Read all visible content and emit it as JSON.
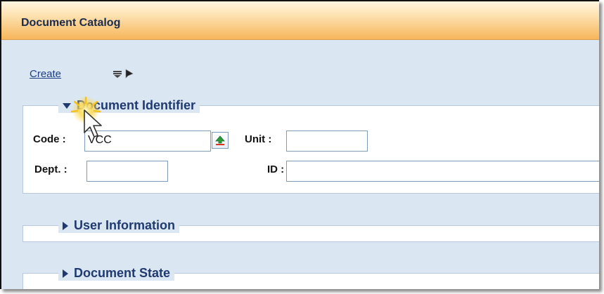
{
  "window": {
    "title": "Document Catalog"
  },
  "toolbar": {
    "create_label": "Create"
  },
  "sections": {
    "document_identifier": {
      "legend": "Document Identifier",
      "expanded": true,
      "fields": {
        "code": {
          "label": "Code :",
          "value": "VCC"
        },
        "unit": {
          "label": "Unit :",
          "value": ""
        },
        "dept": {
          "label": "Dept. :",
          "value": ""
        },
        "id": {
          "label": "ID :",
          "value": ""
        }
      }
    },
    "user_information": {
      "legend": "User Information",
      "expanded": false
    },
    "document_state": {
      "legend": "Document State",
      "expanded": false
    }
  },
  "colors": {
    "titlebar_orange": "#f9c77c",
    "panel_blue": "#dbe6f3",
    "link_blue": "#1d3e87",
    "legend_navy": "#1f3a70",
    "lookup_green": "#2e9b3a",
    "lookup_red": "#d9381e"
  },
  "icons": {
    "toolbar": [
      "dropdown-arrow-icon",
      "pointer-cursor-icon"
    ],
    "code_lookup": "lookup-up-arrow-icon"
  }
}
